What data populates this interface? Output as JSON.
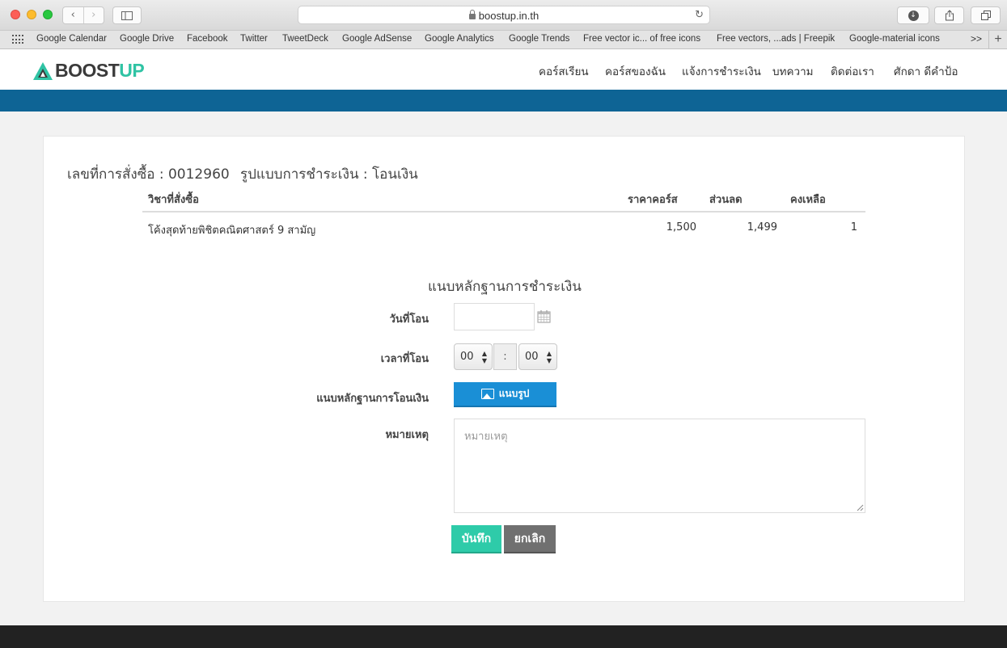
{
  "browser": {
    "url": "boostup.in.th",
    "bookmarks": [
      "Google Calendar",
      "Google Drive",
      "Facebook",
      "Twitter",
      "TweetDeck",
      "Google AdSense",
      "Google Analytics",
      "Google Trends",
      "Free vector ic... of free icons",
      "Free vectors, ...ads | Freepik",
      "Google-material icons"
    ],
    "more": ">>"
  },
  "site": {
    "logo_boost": "BOOST",
    "logo_up": "UP",
    "brand_color": "#2fc3a4",
    "band_color": "#0e6495",
    "nav": [
      "คอร์สเรียน",
      "คอร์สของฉัน",
      "แจ้งการชำระเงิน",
      "บทความ",
      "ติดต่อเรา",
      "ศักดา ดีคำป้อ"
    ]
  },
  "order": {
    "number_label": "เลขที่การสั่งซื้อ : 0012960",
    "payment_label": "รูปแบบการชำระเงิน : โอนเงิน",
    "columns": [
      "วิชาที่สั่งซื้อ",
      "ราคาคอร์ส",
      "ส่วนลด",
      "คงเหลือ"
    ],
    "rows": [
      {
        "course": "โค้งสุดท้ายพิชิตคณิตศาสตร์ 9 สามัญ",
        "price": "1,500",
        "discount": "1,499",
        "remaining": "1"
      }
    ]
  },
  "form": {
    "title": "แนบหลักฐานการชำระเงิน",
    "date_label": "วันที่โอน",
    "date_value": "",
    "time_label": "เวลาที่โอน",
    "hour": "00",
    "minute": "00",
    "colon": ":",
    "attach_label": "แนบหลักฐานการโอนเงิน",
    "attach_button": "แนบรูป",
    "note_label": "หมายเหตุ",
    "note_placeholder": "หมายเหตุ",
    "save": "บันทึก",
    "cancel": "ยกเลิก"
  }
}
